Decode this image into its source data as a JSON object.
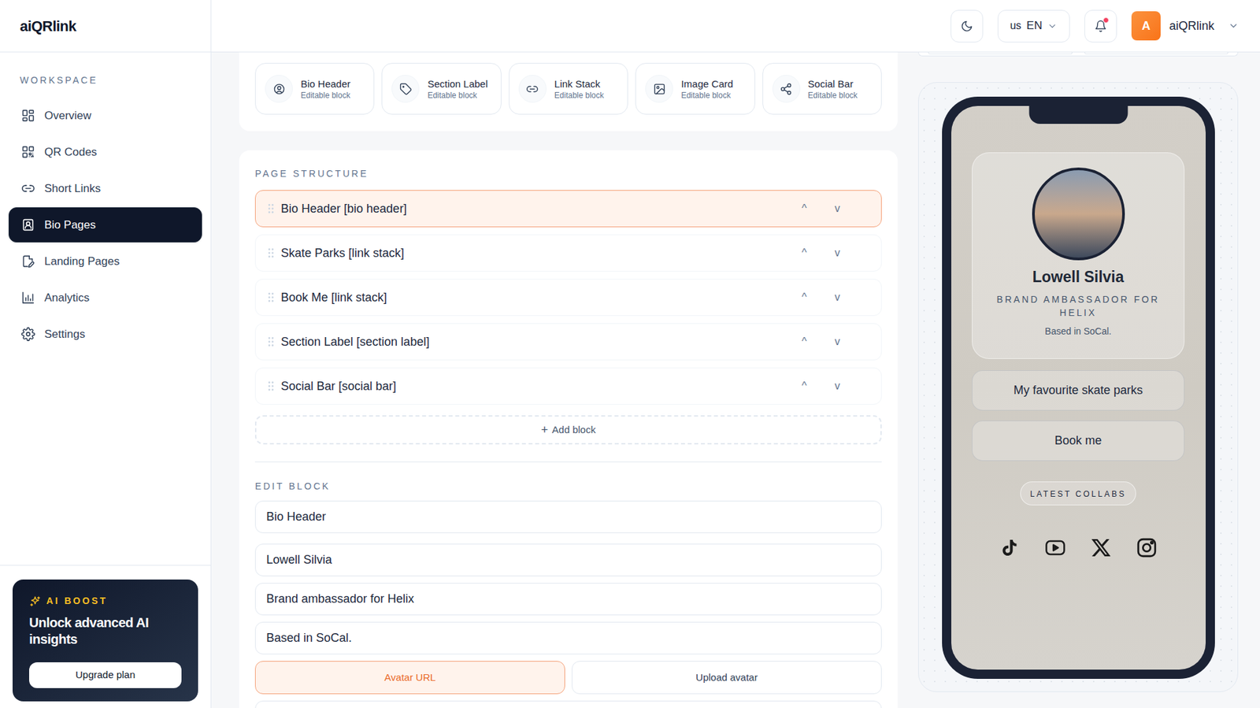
{
  "app": {
    "logo": "aiQRlink"
  },
  "sidebar": {
    "section": "WORKSPACE",
    "items": [
      {
        "label": "Overview",
        "selected": false
      },
      {
        "label": "QR Codes",
        "selected": false
      },
      {
        "label": "Short Links",
        "selected": false
      },
      {
        "label": "Bio Pages",
        "selected": true
      },
      {
        "label": "Landing Pages",
        "selected": false
      },
      {
        "label": "Analytics",
        "selected": false
      },
      {
        "label": "Settings",
        "selected": false
      }
    ]
  },
  "promo": {
    "badge": "AI BOOST",
    "title": "Unlock advanced AI insights",
    "button": "Upgrade plan"
  },
  "header": {
    "language": {
      "flag": "us",
      "code": "EN"
    },
    "notifications": {
      "unread": true
    },
    "user": {
      "initial": "A",
      "name": "aiQRlink"
    }
  },
  "palette": [
    {
      "label": "Bio Header",
      "caption": "Editable block"
    },
    {
      "label": "Section Label",
      "caption": "Editable block"
    },
    {
      "label": "Link Stack",
      "caption": "Editable block"
    },
    {
      "label": "Image Card",
      "caption": "Editable block"
    },
    {
      "label": "Social Bar",
      "caption": "Editable block"
    }
  ],
  "structure": {
    "title": "PAGE STRUCTURE",
    "move_up": "^",
    "move_down": "v",
    "rows": [
      {
        "label": "Bio Header [bio header]",
        "selected": true
      },
      {
        "label": "Skate Parks [link stack]",
        "selected": false
      },
      {
        "label": "Book Me [link stack]",
        "selected": false
      },
      {
        "label": "Section Label [section label]",
        "selected": false
      },
      {
        "label": "Social Bar [social bar]",
        "selected": false
      }
    ],
    "add_icon": "+",
    "add": "Add block"
  },
  "edit": {
    "title": "EDIT BLOCK",
    "fields": [
      "Bio Header",
      "Lowell Silvia",
      "Brand ambassador for Helix",
      "Based in SoCal."
    ],
    "avatar_modes": [
      {
        "label": "Avatar URL",
        "selected": true
      },
      {
        "label": "Upload avatar",
        "selected": false
      }
    ]
  },
  "preview": {
    "name": "Lowell Silvia",
    "subtitle": "BRAND AMBASSADOR FOR HELIX",
    "location": "Based in SoCal.",
    "links": [
      "My favourite skate parks",
      "Book me"
    ],
    "section_label": "LATEST COLLABS"
  }
}
